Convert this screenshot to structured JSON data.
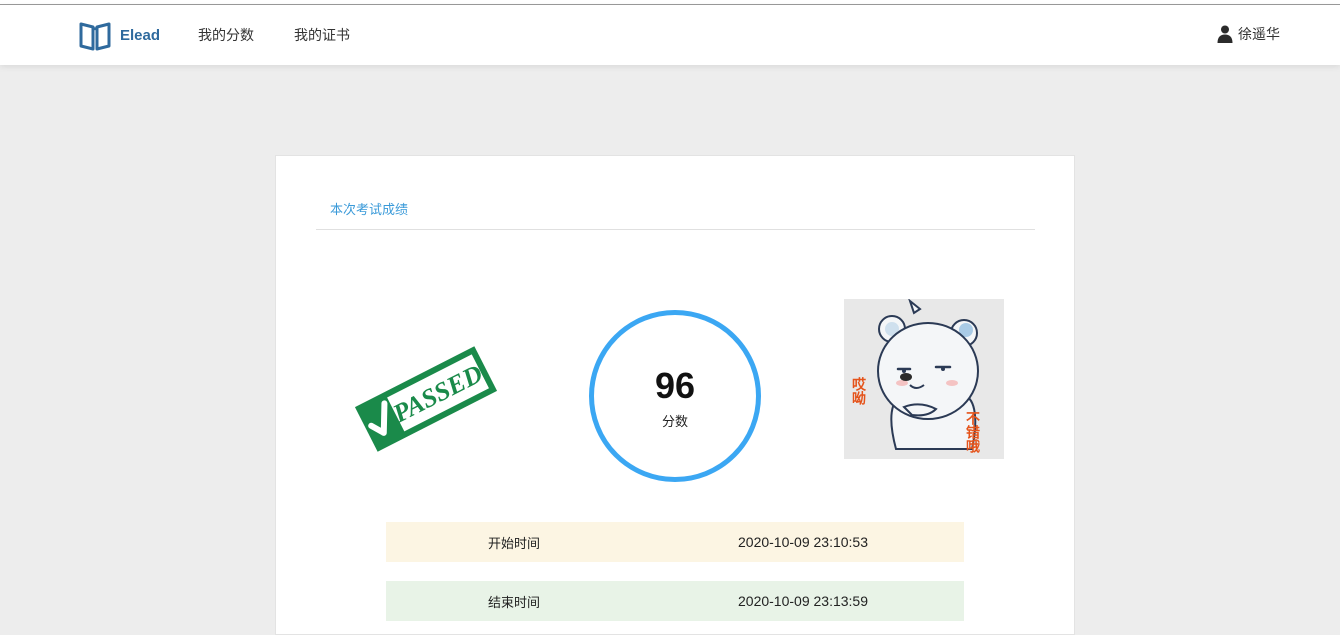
{
  "navbar": {
    "brand_name": "Elead",
    "links": [
      {
        "label": "我的分数"
      },
      {
        "label": "我的证书"
      }
    ],
    "user_name": "徐遥华"
  },
  "result": {
    "title": "本次考试成绩",
    "score": "96",
    "score_label": "分数",
    "stamp_text": "PASSED",
    "sticker_text_left": "哎呦",
    "sticker_text_right": "不错哦",
    "rows": [
      {
        "label": "开始时间",
        "value": "2020-10-09 23:10:53"
      },
      {
        "label": "结束时间",
        "value": "2020-10-09 23:13:59"
      }
    ]
  },
  "colors": {
    "accent": "#3ba7f3",
    "brand": "#2f6a9d",
    "stamp_green": "#1a8a4a",
    "sticker_red": "#e5531a"
  }
}
